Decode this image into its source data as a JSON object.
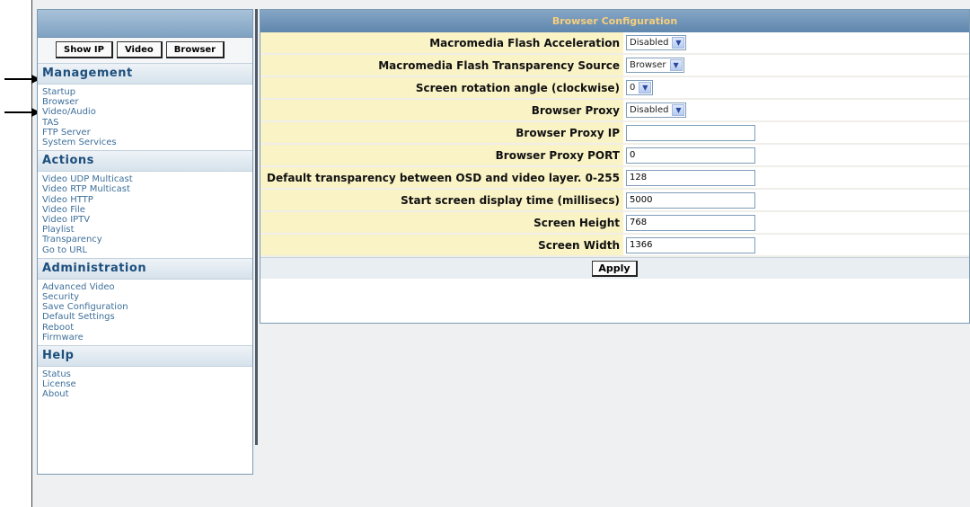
{
  "sidebar": {
    "buttons": [
      "Show IP",
      "Video",
      "Browser"
    ],
    "sections": [
      {
        "title": "Management",
        "items": [
          "Startup",
          "Browser",
          "Video/Audio",
          "TAS",
          "FTP Server",
          "System Services"
        ]
      },
      {
        "title": "Actions",
        "items": [
          "Video UDP Multicast",
          "Video RTP Multicast",
          "Video HTTP",
          "Video File",
          "Video IPTV",
          "Playlist",
          "Transparency",
          "Go to URL"
        ]
      },
      {
        "title": "Administration",
        "items": [
          "Advanced Video",
          "Security",
          "Save Configuration",
          "Default Settings",
          "Reboot",
          "Firmware"
        ]
      },
      {
        "title": "Help",
        "items": [
          "Status",
          "License",
          "About"
        ]
      }
    ]
  },
  "main": {
    "title": "Browser Configuration",
    "rows": [
      {
        "label": "Macromedia Flash Acceleration",
        "type": "select",
        "value": "Disabled"
      },
      {
        "label": "Macromedia Flash Transparency Source",
        "type": "select",
        "value": "Browser"
      },
      {
        "label": "Screen rotation angle (clockwise)",
        "type": "select",
        "value": "0"
      },
      {
        "label": "Browser Proxy",
        "type": "select",
        "value": "Disabled"
      },
      {
        "label": "Browser Proxy IP",
        "type": "text",
        "value": ""
      },
      {
        "label": "Browser Proxy PORT",
        "type": "text",
        "value": "0"
      },
      {
        "label": "Default transparency between OSD and video layer. 0-255",
        "type": "text",
        "value": "128"
      },
      {
        "label": "Start screen display time (millisecs)",
        "type": "text",
        "value": "5000"
      },
      {
        "label": "Screen Height",
        "type": "text",
        "value": "768"
      },
      {
        "label": "Screen Width",
        "type": "text",
        "value": "1366"
      }
    ],
    "apply_label": "Apply"
  },
  "colors": {
    "title_text": "#f6cf7c",
    "label_bg": "#f9f3c6",
    "section_text": "#1d4f7d",
    "link": "#3d6f9a"
  }
}
